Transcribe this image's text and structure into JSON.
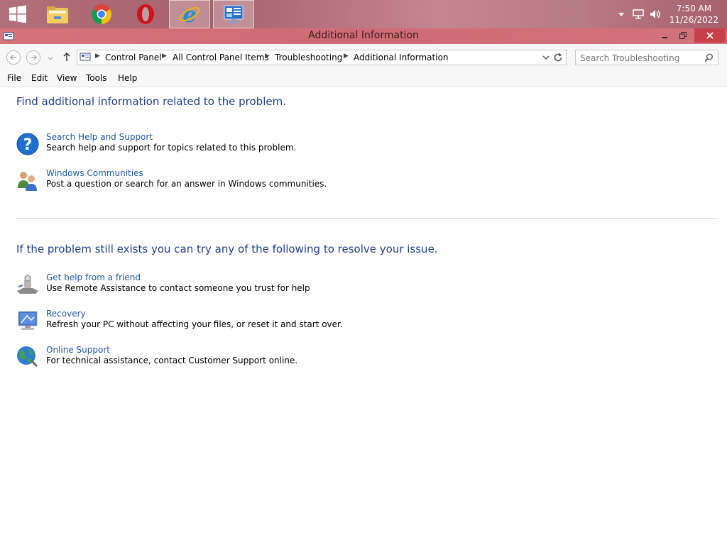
{
  "taskbar": {
    "apps": [
      {
        "name": "windows-start"
      },
      {
        "name": "file-explorer"
      },
      {
        "name": "chrome"
      },
      {
        "name": "opera"
      },
      {
        "name": "internet-explorer"
      },
      {
        "name": "control-panel"
      }
    ],
    "clock_time": "7:50 AM",
    "clock_date": "11/26/2022"
  },
  "window": {
    "title": "Additional Information"
  },
  "address": {
    "breadcrumbs": [
      "Control Panel",
      "All Control Panel Items",
      "Troubleshooting",
      "Additional Information"
    ],
    "search_placeholder": "Search Troubleshooting"
  },
  "menu": {
    "items": [
      "File",
      "Edit",
      "View",
      "Tools",
      "Help"
    ]
  },
  "section1": {
    "heading": "Find additional information related to the problem.",
    "items": [
      {
        "link": "Search Help and Support",
        "desc": "Search help and support for topics related to this problem.",
        "icon": "help-icon"
      },
      {
        "link": "Windows Communities",
        "desc": "Post a question or search for an answer in Windows communities.",
        "icon": "communities-icon"
      }
    ]
  },
  "section2": {
    "heading": "If the problem still exists you can try any of the following to resolve your issue.",
    "items": [
      {
        "link": "Get help from a friend",
        "desc": "Use Remote Assistance to contact someone you trust for help",
        "icon": "remote-assistance-icon"
      },
      {
        "link": "Recovery",
        "desc": "Refresh your PC without affecting your files, or reset it and start over.",
        "icon": "recovery-icon"
      },
      {
        "link": "Online Support",
        "desc": "For technical assistance, contact Customer Support online.",
        "icon": "globe-icon"
      }
    ]
  },
  "colors": {
    "heading": "#1e3f8a",
    "link": "#1e5aa8",
    "titlebar": "#d5727a"
  }
}
